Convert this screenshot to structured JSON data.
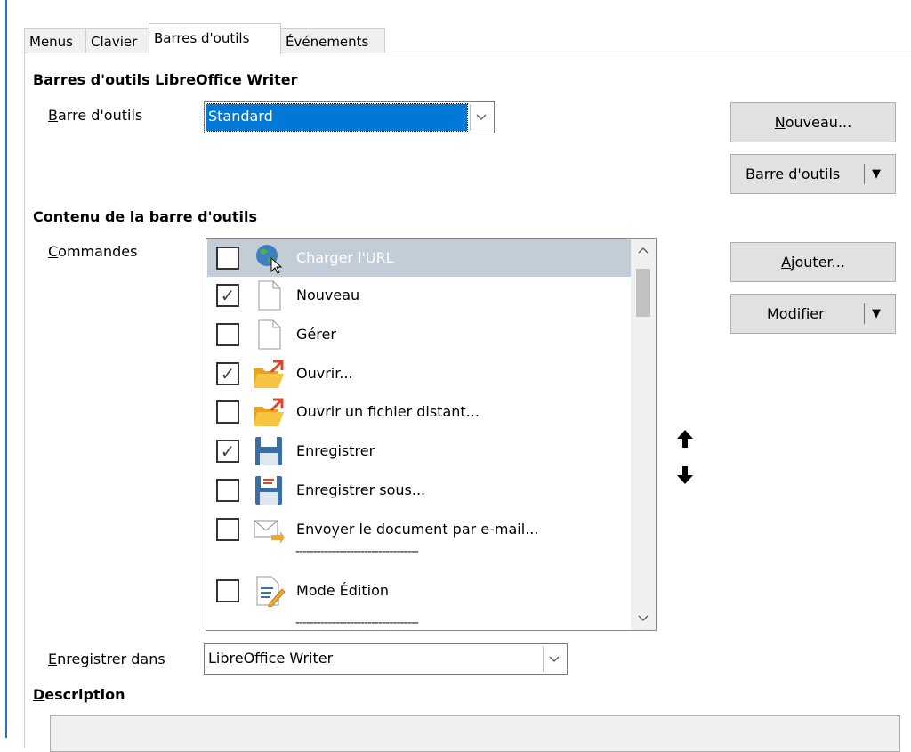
{
  "tabs": [
    {
      "label": "Menus"
    },
    {
      "label": "Clavier"
    },
    {
      "label": "Barres d'outils"
    },
    {
      "label": "Événements"
    }
  ],
  "section_toolbars": {
    "heading": "Barres d'outils LibreOffice Writer",
    "toolbar_label": "Barre d'outils",
    "toolbar_value": "Standard",
    "new_button": "Nouveau...",
    "toolbar_button": "Barre d'outils"
  },
  "section_content": {
    "heading": "Contenu de la barre d'outils",
    "commands_label": "Commandes",
    "add_button": "Ajouter...",
    "modify_button": "Modifier",
    "commands": [
      {
        "label": "Charger l'URL",
        "checked": false,
        "icon": "globe-icon",
        "selected": true
      },
      {
        "label": "Nouveau",
        "checked": true,
        "icon": "document-icon"
      },
      {
        "label": "Gérer",
        "checked": false,
        "icon": "document-icon"
      },
      {
        "label": "Ouvrir...",
        "checked": true,
        "icon": "folder-open-icon"
      },
      {
        "label": "Ouvrir un fichier distant...",
        "checked": false,
        "icon": "folder-open-icon"
      },
      {
        "label": "Enregistrer",
        "checked": true,
        "icon": "floppy-icon"
      },
      {
        "label": "Enregistrer sous...",
        "checked": false,
        "icon": "floppy-saveas-icon"
      },
      {
        "label": "Envoyer le document par e-mail...",
        "checked": false,
        "icon": "envelope-icon"
      },
      {
        "separator": "----------------------------------"
      },
      {
        "label": "Mode Édition",
        "checked": false,
        "icon": "edit-mode-icon"
      },
      {
        "separator": "----------------------------------"
      }
    ]
  },
  "save_in": {
    "label": "Enregistrer dans",
    "value": "LibreOffice Writer"
  },
  "description": {
    "heading": "Description"
  }
}
